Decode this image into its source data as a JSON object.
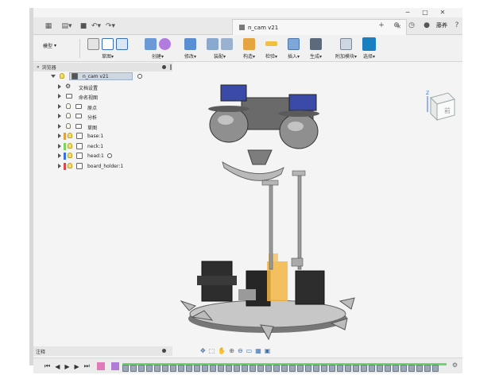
{
  "window": {
    "minimize": "─",
    "maximize": "□",
    "close": "✕"
  },
  "titlebar": {
    "doc_title": "n_cam v21",
    "user_label": "藤养"
  },
  "ribbon": {
    "workspace": "模型",
    "groups": [
      {
        "label": "草图",
        "has_menu": true
      },
      {
        "label": "创建",
        "has_menu": true
      },
      {
        "label": "修改",
        "has_menu": true
      },
      {
        "label": "装配",
        "has_menu": true
      },
      {
        "label": "构造",
        "has_menu": true
      },
      {
        "label": "检验",
        "has_menu": true
      },
      {
        "label": "插入",
        "has_menu": true
      },
      {
        "label": "生成",
        "has_menu": true
      },
      {
        "label": "附加模块",
        "has_menu": true
      },
      {
        "label": "选择",
        "has_menu": true
      }
    ],
    "menu_caret": "▾"
  },
  "browser": {
    "title": "浏览器",
    "root": "n_cam v21",
    "items": [
      {
        "label": "文档设置",
        "kind": "gear"
      },
      {
        "label": "命名视图",
        "kind": "folder"
      },
      {
        "label": "原点",
        "kind": "folder-bulb"
      },
      {
        "label": "分析",
        "kind": "folder-bulb"
      },
      {
        "label": "草图",
        "kind": "folder-bulb"
      },
      {
        "label": "base:1",
        "kind": "component",
        "color": "#e0a040"
      },
      {
        "label": "neck:1",
        "kind": "component",
        "color": "#7fd35c"
      },
      {
        "label": "head:1",
        "kind": "component",
        "color": "#3b6fd9"
      },
      {
        "label": "board_holder:1",
        "kind": "component",
        "color": "#d94b4b"
      }
    ]
  },
  "comments": {
    "title": "注释"
  },
  "viewcube": {
    "face": "前",
    "axis_z": "Z",
    "axis_x": "X"
  },
  "colors": {
    "accent": "#1a7fc1",
    "timeline_green": "#6dd66d"
  }
}
